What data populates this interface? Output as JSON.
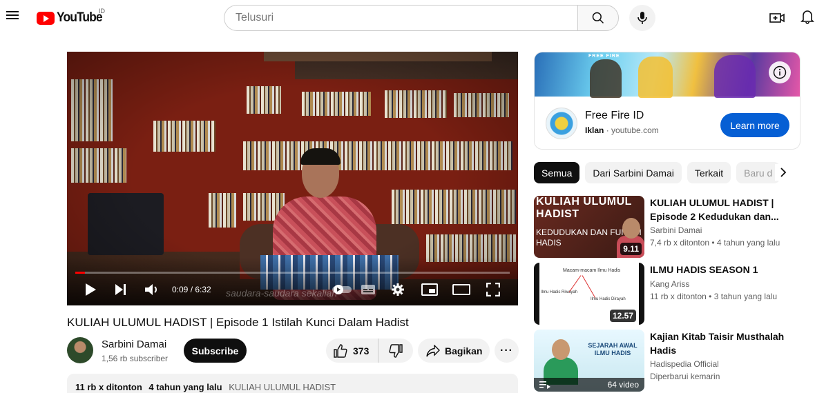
{
  "header": {
    "logo_text": "YouTube",
    "country_code": "ID",
    "search_placeholder": "Telusuri"
  },
  "player": {
    "current_time": "0:09",
    "separator": " / ",
    "duration": "6:32",
    "progress_fraction": 0.023,
    "watermark": "saudara-saudara sekalian"
  },
  "video": {
    "title": "KULIAH ULUMUL HADIST | Episode 1 Istilah Kunci Dalam Hadist",
    "channel_name": "Sarbini Damai",
    "subscribers": "1,56 rb subscriber",
    "subscribe_label": "Subscribe",
    "like_count": "373",
    "share_label": "Bagikan",
    "more_label": "···",
    "desc_views": "11 rb x ditonton",
    "desc_age": "4 tahun yang lalu",
    "desc_tag": "KULIAH ULUMUL HADIST"
  },
  "ad": {
    "banner_mark": "FREE FIRE",
    "title": "Free Fire ID",
    "sponsor_label": "Iklan",
    "dot": " · ",
    "domain": "youtube.com",
    "cta_label": "Learn more"
  },
  "chips": [
    "Semua",
    "Dari Sarbini Damai",
    "Terkait",
    "Baru d"
  ],
  "recommendations": [
    {
      "title": "KULIAH ULUMUL HADIST | Episode 2 Kedudukan dan...",
      "channel": "Sarbini Damai",
      "meta": "7,4 rb x ditonton  • 4 tahun yang lalu",
      "duration": "9.11",
      "thumb_line1": "KULIAH ULUMUL HADIST",
      "thumb_line2": "KEDUDUKAN DAN FUNGSI HADIS"
    },
    {
      "title": "ILMU HADIS SEASON 1",
      "channel": "Kang Ariss",
      "meta": "11 rb x ditonton  • 3 tahun yang lalu",
      "duration": "12.57",
      "thumb_head": "Macam-macam Ilmu Hadis",
      "thumb_left": "Ilmu Hadis Riwayah",
      "thumb_right": "Ilmu Hadis Dirayah"
    },
    {
      "title": "Kajian Kitab Taisir Musthalah Hadis",
      "channel": "Hadispedia Official",
      "meta": "Diperbarui kemarin",
      "video_count": "64 video",
      "thumb_head": "SEJARAH AWAL ILMU HADIS"
    }
  ],
  "colors": {
    "brand_red": "#ff0000",
    "cta_blue": "#065fd4",
    "chip_active": "#0f0f0f"
  },
  "icons": [
    "menu-icon",
    "search-icon",
    "mic-icon",
    "create-icon",
    "bell-icon",
    "play-icon",
    "next-icon",
    "volume-icon",
    "settings-icon",
    "miniplayer-icon",
    "theater-icon",
    "fullscreen-icon",
    "like-icon",
    "dislike-icon",
    "share-icon",
    "info-icon",
    "chevron-right-icon",
    "playlist-icon"
  ]
}
